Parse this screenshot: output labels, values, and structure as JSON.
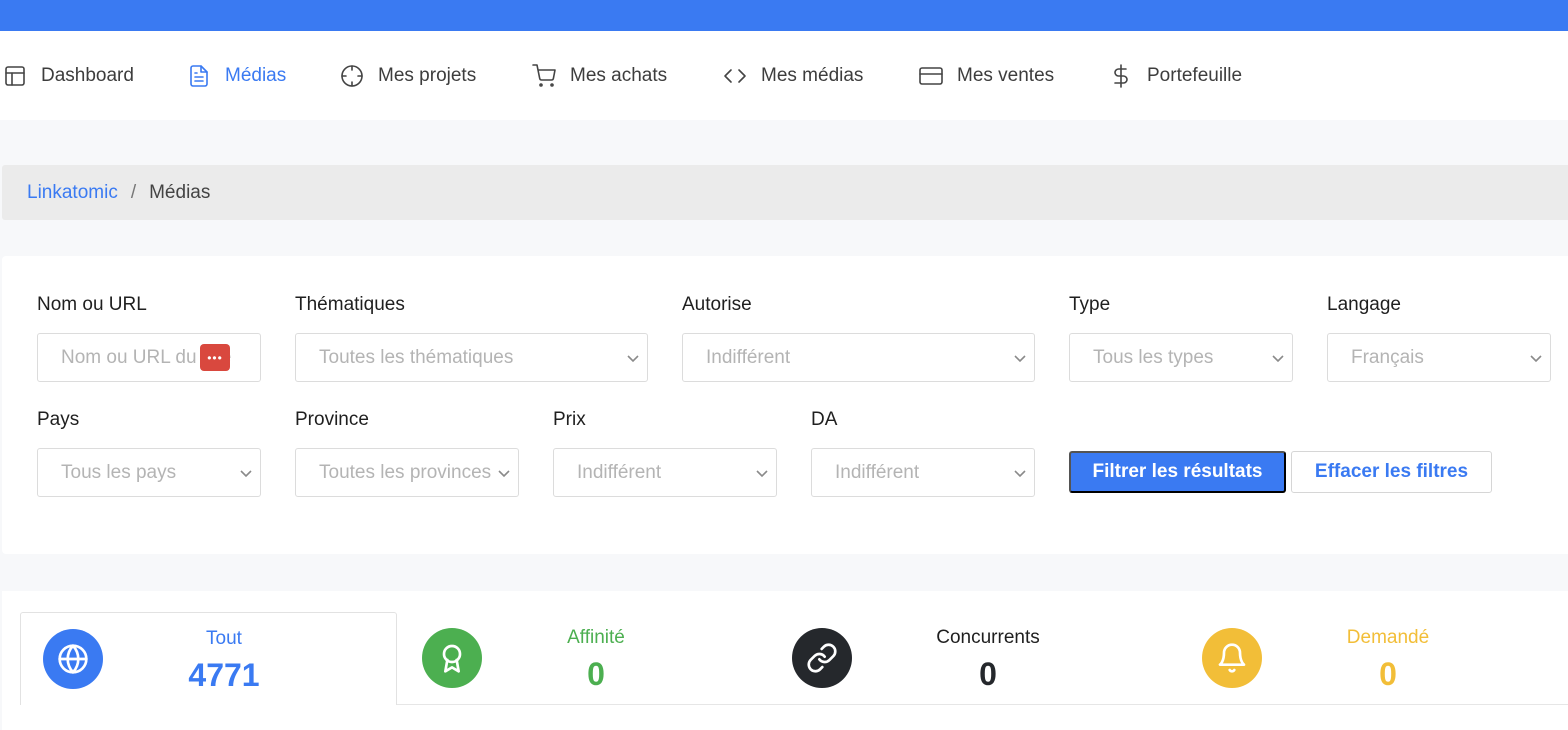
{
  "nav": {
    "items": [
      {
        "label": "Dashboard",
        "icon": "layout-icon",
        "active": false
      },
      {
        "label": "Médias",
        "icon": "document-icon",
        "active": true
      },
      {
        "label": "Mes projets",
        "icon": "crosshair-icon",
        "active": false
      },
      {
        "label": "Mes achats",
        "icon": "cart-icon",
        "active": false
      },
      {
        "label": "Mes médias",
        "icon": "code-icon",
        "active": false
      },
      {
        "label": "Mes ventes",
        "icon": "credit-card-icon",
        "active": false
      },
      {
        "label": "Portefeuille",
        "icon": "dollar-icon",
        "active": false
      }
    ]
  },
  "breadcrumb": {
    "root": "Linkatomic",
    "separator": "/",
    "current": "Médias"
  },
  "filters": {
    "name": {
      "label": "Nom ou URL",
      "placeholder": "Nom ou URL du site"
    },
    "themes": {
      "label": "Thématiques",
      "value": "Toutes les thématiques"
    },
    "authorized": {
      "label": "Autorise",
      "value": "Indifférent"
    },
    "type": {
      "label": "Type",
      "value": "Tous les types"
    },
    "language": {
      "label": "Langage",
      "value": "Français"
    },
    "country": {
      "label": "Pays",
      "value": "Tous les pays"
    },
    "province": {
      "label": "Province",
      "value": "Toutes les provinces"
    },
    "price": {
      "label": "Prix",
      "value": "Indifférent"
    },
    "da": {
      "label": "DA",
      "value": "Indifférent"
    },
    "apply_label": "Filtrer les résultats",
    "clear_label": "Effacer les filtres"
  },
  "stats": [
    {
      "label": "Tout",
      "value": "4771",
      "icon": "globe-icon",
      "color": "#3a7af2"
    },
    {
      "label": "Affinité",
      "value": "0",
      "icon": "award-icon",
      "color": "#4caf50"
    },
    {
      "label": "Concurrents",
      "value": "0",
      "icon": "link-icon",
      "color": "#25282c"
    },
    {
      "label": "Demandé",
      "value": "0",
      "icon": "bell-icon",
      "color": "#f2be38"
    }
  ],
  "colors": {
    "accent": "#3a7af2",
    "success": "#4caf50",
    "dark": "#25282c",
    "warning": "#f2be38",
    "password_manager": "#d9483e"
  }
}
